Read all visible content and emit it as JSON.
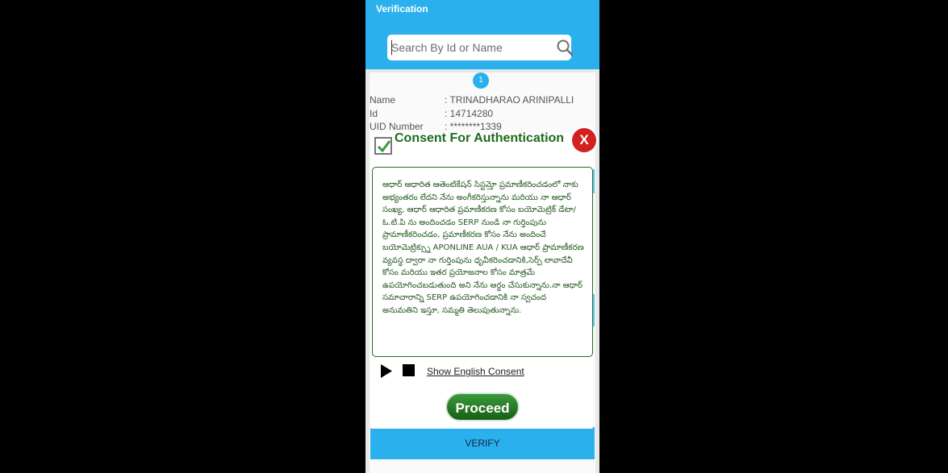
{
  "header": {
    "title": "Verification"
  },
  "search": {
    "placeholder": "Search By Id or Name"
  },
  "record": {
    "index": "1",
    "fields": [
      {
        "label": "Name",
        "value": ": TRINADHARAO ARINIPALLI"
      },
      {
        "label": "Id",
        "value": ": 14714280"
      },
      {
        "label": "UID Number",
        "value": ": ********1339"
      }
    ]
  },
  "dialog": {
    "title": "Consent For Authentication",
    "close_label": "X",
    "checked": true,
    "consent_text": "ఆధార్ ఆధారిత ఆతెంటికేషన్ సిస్టమ్తో ప్రమాణీకరించడంలో నాకు అభ్యంతరం లేదని నేను అంగీకరిస్తున్నాను మరియు నా ఆధార్ సంఖ్య, ఆధార్ ఆధారిత ప్రమాణీకరణ కోసం బయోమెట్రిక్ డేటా/ఓ.టి.పి ను అందించడం SERP నుండి నా గుర్తింపును ప్రామాణీకరించడం, ప్రమాణీకరణ కోసం నేను అందించే బయోమెట్రిక్స్ను APONLINE AUA / KUA ఆధార్ ప్రామాణీకరణ వ్యవస్థ ద్వారా నా గుర్తింపును ధృవీకరించడానికి,సెర్ప్ లావాదేవీ కోసం మరియు ఇతర ప్రయోజనాల కోసం మాత్రమే ఉపయోగించబడుతుంది అని నేను అర్థం చేసుకున్నాను.నా ఆధార్ సమాచారాన్ని SERP ఉపయోగించడానికి నా స్వచంద అనుమతిని ఇస్తూ, సమ్మతి తెలుపుతున్నాను.",
    "english_link": "Show English Consent",
    "proceed_label": "Proceed"
  },
  "footer": {
    "verify_label": "VERIFY"
  },
  "colors": {
    "accent": "#2ab0ec",
    "consent_green": "#1d6b1d",
    "close_red": "#d32020"
  }
}
